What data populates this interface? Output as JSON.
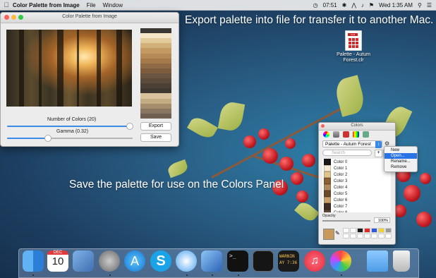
{
  "menubar": {
    "app_name": "Color Palette from Image",
    "menus": [
      "File",
      "Window"
    ],
    "time_small": "07:51",
    "clock": "Wed 1:35 AM",
    "search_icon": "search-icon",
    "list_icon": "list-icon"
  },
  "overlay": {
    "top_text": "Export palette into file for transfer it to another Mac.",
    "middle_text": "Save the palette for use on the Colors Panel"
  },
  "window": {
    "title": "Color Palette from Image",
    "number_of_colors_label": "Number of Colors (20)",
    "number_of_colors_value": 20,
    "number_of_colors_fraction": 0.97,
    "gamma_label": "Gamma (0.32)",
    "gamma_value": 0.32,
    "gamma_fraction": 0.32,
    "export_label": "Export",
    "save_label": "Save",
    "swatch_colors": [
      "#3a3833",
      "#f5e6c7",
      "#e3cc9c",
      "#d2b07a",
      "#c29a62",
      "#b68a57",
      "#a57a4b",
      "#8e6a45",
      "#7c5c3d",
      "#6b5440",
      "#5c4a3b",
      "#4a4036",
      "#3e3830",
      "#d9c39c",
      "#c4ac82",
      "#a48c6c",
      "#8a7660",
      "#6e6050"
    ]
  },
  "file": {
    "badge": "CLR",
    "name": "Palette - Autum Forest.clr"
  },
  "colors_panel": {
    "title": "Colors",
    "palette_name": "Palette - Autum Forest",
    "search_placeholder": "Search",
    "opacity_label": "Opacity",
    "opacity_value": "100%",
    "colors": [
      {
        "name": "Color 0",
        "hex": "#1a1816"
      },
      {
        "name": "Color 1",
        "hex": "#f4ead0"
      },
      {
        "name": "Color 2",
        "hex": "#e0c48c"
      },
      {
        "name": "Color 3",
        "hex": "#8c5f35"
      },
      {
        "name": "Color 4",
        "hex": "#b08a5a"
      },
      {
        "name": "Color 5",
        "hex": "#6e4a2c"
      },
      {
        "name": "Color 6",
        "hex": "#c9a06a"
      },
      {
        "name": "Color 7",
        "hex": "#3e2d20"
      },
      {
        "name": "Color 8",
        "hex": "#5b4636"
      }
    ],
    "well_color": "#c79a5b",
    "mini_swatches": [
      "#ffffff",
      "#ffffff",
      "#1b1b1b",
      "#e02a2a",
      "#2a5be0",
      "#f1d233",
      "#9a9a9a",
      "#ffffff",
      "#ffffff",
      "#ffffff",
      "#ffffff",
      "#ffffff",
      "#ffffff",
      "#ffffff"
    ]
  },
  "context_menu": {
    "items": [
      "New",
      "Open...",
      "Rename...",
      "Remove"
    ],
    "highlighted": "Open..."
  },
  "dock": {
    "apps": [
      "Finder",
      "Calendar",
      "Preview",
      "Launchpad",
      "App Store",
      "Skype",
      "Safari",
      "Xcode",
      "Terminal",
      "Activity Monitor",
      "Console",
      "iTunes",
      "Color Palette from Image",
      "Downloads",
      "Trash"
    ],
    "calendar_month": "DEC",
    "calendar_day": "10",
    "console_text": "WARNIN\nAY 7:36"
  }
}
